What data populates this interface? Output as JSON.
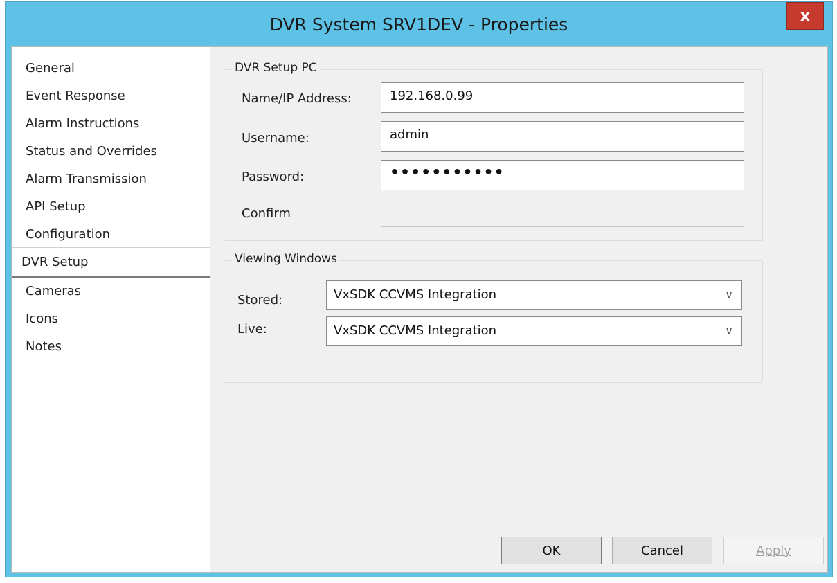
{
  "window": {
    "title": "DVR System SRV1DEV - Properties",
    "close_label": "x"
  },
  "nav": {
    "items": [
      "General",
      "Event Response",
      "Alarm Instructions",
      "Status and Overrides",
      "Alarm Transmission",
      "API Setup",
      "Configuration",
      "DVR Setup",
      "Cameras",
      "Icons",
      "Notes"
    ],
    "selected": "DVR Setup"
  },
  "setup_pc": {
    "group_label": "DVR Setup PC",
    "name_label": "Name/IP Address:",
    "name_value": "192.168.0.99",
    "username_label": "Username:",
    "username_value": "admin",
    "password_label": "Password:",
    "password_value": "•••••••••••",
    "confirm_label": "Confirm",
    "confirm_value": ""
  },
  "viewing": {
    "group_label": "Viewing Windows",
    "stored_label": "Stored:",
    "stored_value": "VxSDK CCVMS Integration",
    "live_label": "Live:",
    "live_value": "VxSDK CCVMS Integration"
  },
  "buttons": {
    "ok": "OK",
    "cancel": "Cancel",
    "apply": "Apply"
  }
}
